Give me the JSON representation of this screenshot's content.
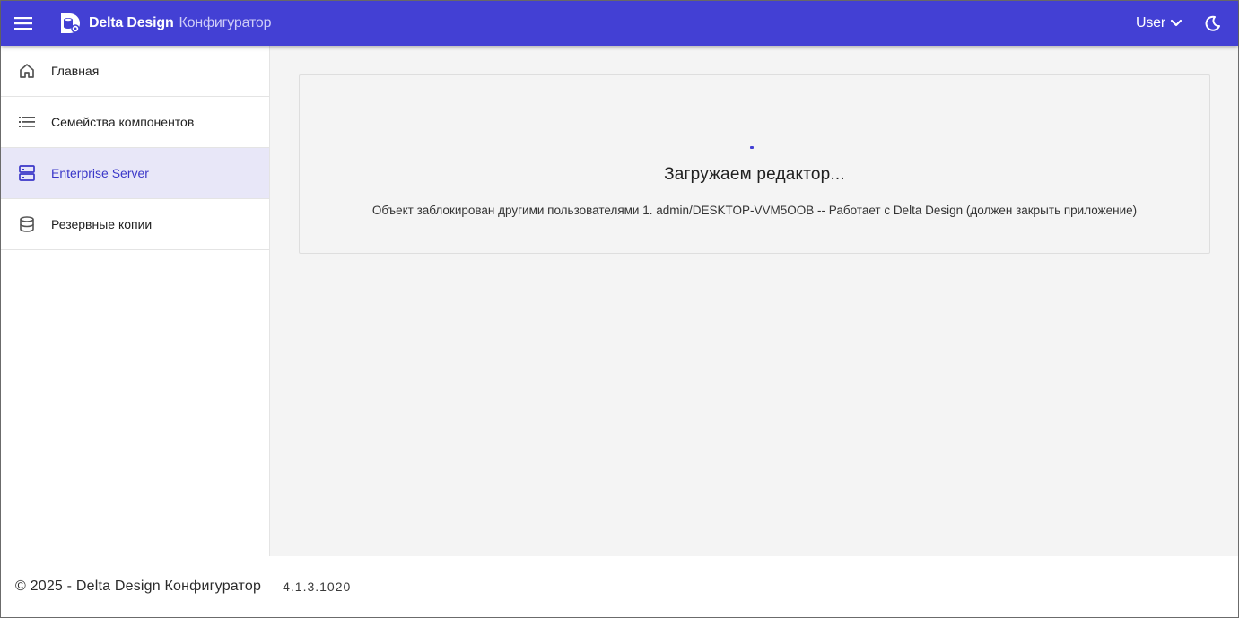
{
  "header": {
    "brand": "Delta Design",
    "brand_sub": "Конфигуратор",
    "user_label": "User",
    "accent_color": "#4340d4",
    "icons": [
      "menu-icon",
      "app-logo-icon",
      "chevron-down-icon",
      "moon-icon"
    ]
  },
  "sidebar": {
    "items": [
      {
        "label": "Главная",
        "icon": "home-icon"
      },
      {
        "label": "Семейства компонентов",
        "icon": "list-icon"
      },
      {
        "label": "Enterprise Server",
        "icon": "server-icon",
        "active": true
      },
      {
        "label": "Резервные копии",
        "icon": "database-icon"
      }
    ]
  },
  "main": {
    "loading_title": "Загружаем редактор...",
    "lock_message": "Объект заблокирован другими пользователями 1. admin/DESKTOP-VVM5OOB -- Работает с Delta Design (должен закрыть приложение)"
  },
  "footer": {
    "copyright": "© 2025 - Delta Design Конфигуратор",
    "version": "4.1.3.1020"
  }
}
